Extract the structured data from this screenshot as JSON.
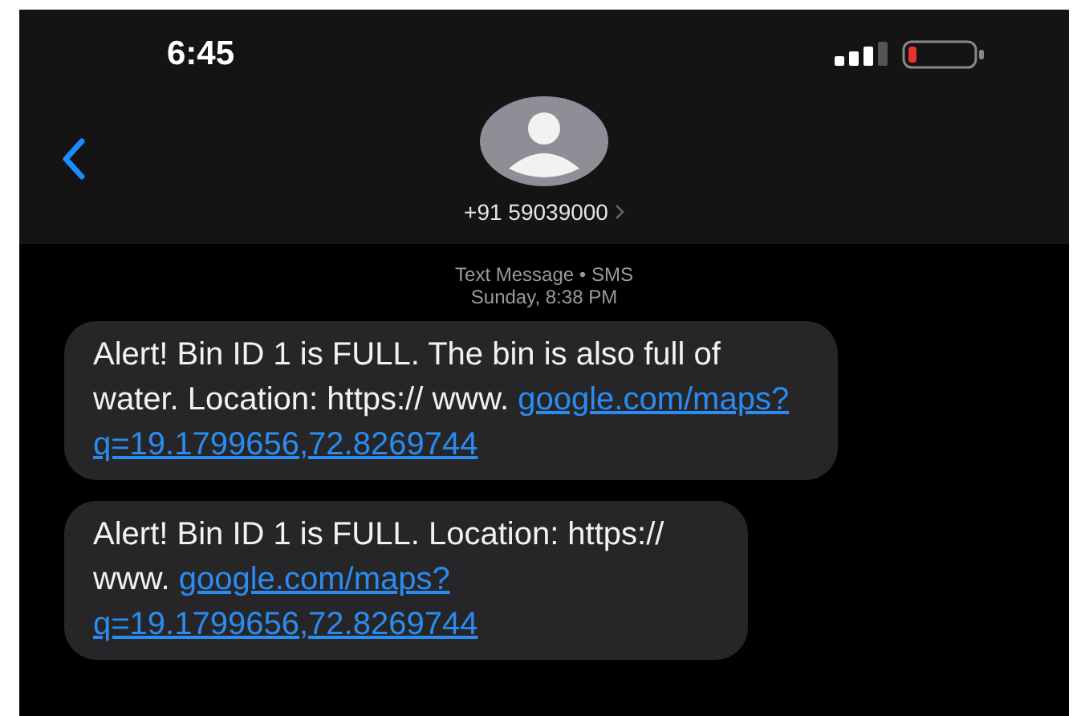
{
  "status_bar": {
    "time": "6:45"
  },
  "contact": {
    "number": "+91 59039000"
  },
  "conversation": {
    "service": "Text Message • SMS",
    "timestamp": "Sunday, 8:38 PM"
  },
  "messages": [
    {
      "text": "Alert! Bin ID 1 is FULL. The bin is also full of water. Location: https:// www.",
      "link": [
        "google.com/maps?",
        "q=19.1799656,72.8269744"
      ]
    },
    {
      "text": "Alert! Bin ID 1 is FULL. Location: https:// www.",
      "link": [
        "google.com/maps?",
        "q=19.1799656,72.8269744"
      ]
    }
  ]
}
